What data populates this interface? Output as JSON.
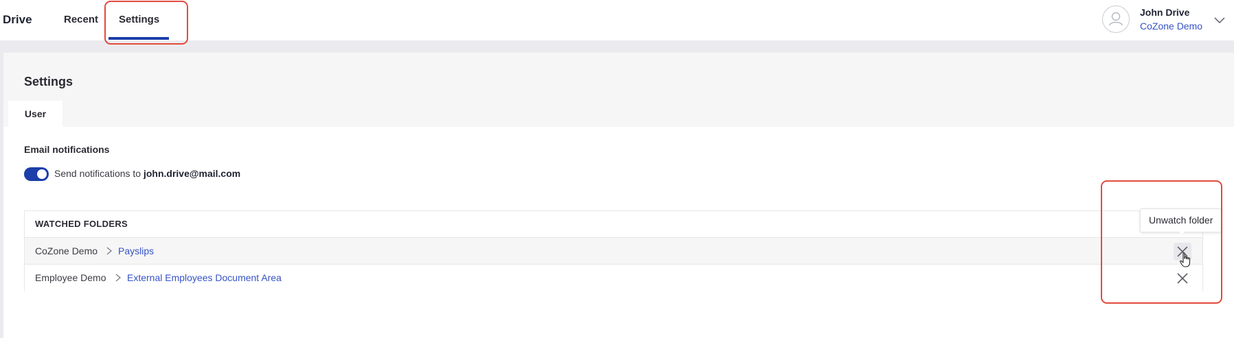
{
  "header": {
    "brand": "Drive",
    "nav": [
      {
        "label": "Recent"
      },
      {
        "label": "Settings"
      }
    ],
    "user": {
      "name": "John Drive",
      "org": "CoZone Demo"
    }
  },
  "settings": {
    "title": "Settings",
    "tabs": [
      {
        "label": "User"
      }
    ],
    "email_notifications": {
      "label": "Email notifications",
      "toggle_on": true,
      "text_prefix": "Send notifications to",
      "email": "john.drive@mail.com"
    },
    "watched_folders": {
      "heading": "WATCHED FOLDERS",
      "rows": [
        {
          "root": "CoZone Demo",
          "folder": "Payslips"
        },
        {
          "root": "Employee Demo",
          "folder": "External Employees Document Area"
        }
      ]
    },
    "tooltip": "Unwatch folder"
  },
  "colors": {
    "accent": "#1b3ea8",
    "link": "#3653c4",
    "annotation": "#e34a3c"
  }
}
